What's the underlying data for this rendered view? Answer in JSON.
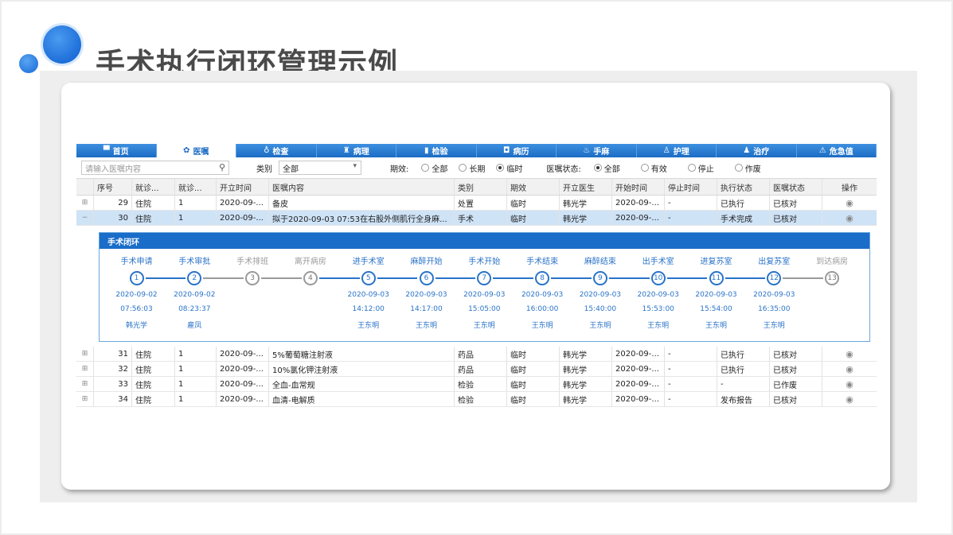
{
  "slide": {
    "title": "手术执行闭环管理示例"
  },
  "tabs": [
    {
      "label": "首页",
      "icon": "home-icon",
      "glyph": "▀"
    },
    {
      "label": "医嘱",
      "icon": "orders-icon",
      "glyph": "✿"
    },
    {
      "label": "检查",
      "icon": "exam-icon",
      "glyph": "♁"
    },
    {
      "label": "病理",
      "icon": "pathology-icon",
      "glyph": "♜"
    },
    {
      "label": "检验",
      "icon": "lab-icon",
      "glyph": "▮"
    },
    {
      "label": "病历",
      "icon": "record-icon",
      "glyph": "◘"
    },
    {
      "label": "手麻",
      "icon": "anesthesia-icon",
      "glyph": "♨"
    },
    {
      "label": "护理",
      "icon": "nursing-icon",
      "glyph": "♙"
    },
    {
      "label": "治疗",
      "icon": "treatment-icon",
      "glyph": "♟"
    },
    {
      "label": "危急值",
      "icon": "warning-icon",
      "glyph": "⚠"
    }
  ],
  "filter": {
    "search_placeholder": "请输入医嘱内容",
    "category_label": "类别",
    "category_value": "全部",
    "period_label": "期效:",
    "period_options": [
      "全部",
      "长期",
      "临时"
    ],
    "status_label": "医嘱状态:",
    "status_options": [
      "全部",
      "有效",
      "停止",
      "作废"
    ]
  },
  "columns": [
    "序号",
    "就诊...",
    "就诊...",
    "开立时间",
    "医嘱内容",
    "类别",
    "期效",
    "开立医生",
    "开始时间",
    "停止时间",
    "执行状态",
    "医嘱状态",
    "操作"
  ],
  "rows_top": [
    {
      "no": "29",
      "v1": "住院",
      "v2": "1",
      "time": "2020-09-...",
      "content": "备皮",
      "cat": "处置",
      "period": "临时",
      "doctor": "韩光学",
      "start": "2020-09-...",
      "stop": "-",
      "exec": "已执行",
      "status": "已核对"
    },
    {
      "no": "30",
      "v1": "住院",
      "v2": "1",
      "time": "2020-09-...",
      "content": "拟于2020-09-03 07:53在右股外侧肌行全身麻...",
      "cat": "手术",
      "period": "临时",
      "doctor": "韩光学",
      "start": "2020-09-...",
      "stop": "-",
      "exec": "手术完成",
      "status": "已核对"
    }
  ],
  "closed_loop": {
    "title": "手术闭环",
    "steps": [
      {
        "name": "手术申请",
        "num": "1",
        "date": "2020-09-02",
        "time": "07:56:03",
        "person": "韩光学",
        "done": true
      },
      {
        "name": "手术审批",
        "num": "2",
        "date": "2020-09-02",
        "time": "08:23:37",
        "person": "雇凤",
        "done": true
      },
      {
        "name": "手术排班",
        "num": "3",
        "date": "",
        "time": "",
        "person": "",
        "done": false
      },
      {
        "name": "离开病房",
        "num": "4",
        "date": "",
        "time": "",
        "person": "",
        "done": false
      },
      {
        "name": "进手术室",
        "num": "5",
        "date": "2020-09-03",
        "time": "14:12:00",
        "person": "王东明",
        "done": true
      },
      {
        "name": "麻醉开始",
        "num": "6",
        "date": "2020-09-03",
        "time": "14:17:00",
        "person": "王东明",
        "done": true
      },
      {
        "name": "手术开始",
        "num": "7",
        "date": "2020-09-03",
        "time": "15:05:00",
        "person": "王东明",
        "done": true
      },
      {
        "name": "手术结束",
        "num": "8",
        "date": "2020-09-03",
        "time": "16:00:00",
        "person": "王东明",
        "done": true
      },
      {
        "name": "麻醉结束",
        "num": "9",
        "date": "2020-09-03",
        "time": "15:40:00",
        "person": "王东明",
        "done": true
      },
      {
        "name": "出手术室",
        "num": "10",
        "date": "2020-09-03",
        "time": "15:53:00",
        "person": "王东明",
        "done": true
      },
      {
        "name": "进复苏室",
        "num": "11",
        "date": "2020-09-03",
        "time": "15:54:00",
        "person": "王东明",
        "done": true
      },
      {
        "name": "出复苏室",
        "num": "12",
        "date": "2020-09-03",
        "time": "16:35:00",
        "person": "王东明",
        "done": true
      },
      {
        "name": "到达病房",
        "num": "13",
        "date": "",
        "time": "",
        "person": "",
        "done": false
      }
    ]
  },
  "rows_bottom": [
    {
      "no": "31",
      "v1": "住院",
      "v2": "1",
      "time": "2020-09-...",
      "content": "5%葡萄糖注射液",
      "cat": "药品",
      "period": "临时",
      "doctor": "韩光学",
      "start": "2020-09-...",
      "stop": "-",
      "exec": "已执行",
      "status": "已核对"
    },
    {
      "no": "32",
      "v1": "住院",
      "v2": "1",
      "time": "2020-09-...",
      "content": "10%氯化钾注射液",
      "cat": "药品",
      "period": "临时",
      "doctor": "韩光学",
      "start": "2020-09-...",
      "stop": "-",
      "exec": "已执行",
      "status": "已核对"
    },
    {
      "no": "33",
      "v1": "住院",
      "v2": "1",
      "time": "2020-09-...",
      "content": "全血-血常规",
      "cat": "检验",
      "period": "临时",
      "doctor": "韩光学",
      "start": "2020-09-...",
      "stop": "-",
      "exec": "-",
      "status": "已作废"
    },
    {
      "no": "34",
      "v1": "住院",
      "v2": "1",
      "time": "2020-09-...",
      "content": "血清-电解质",
      "cat": "检验",
      "period": "临时",
      "doctor": "韩光学",
      "start": "2020-09-...",
      "stop": "-",
      "exec": "发布报告",
      "status": "已核对"
    }
  ],
  "colors": {
    "accent": "#1c6cc4",
    "done": "#2a73c8",
    "pending": "#9a9a9a",
    "selected_row": "#cfe3f7"
  }
}
